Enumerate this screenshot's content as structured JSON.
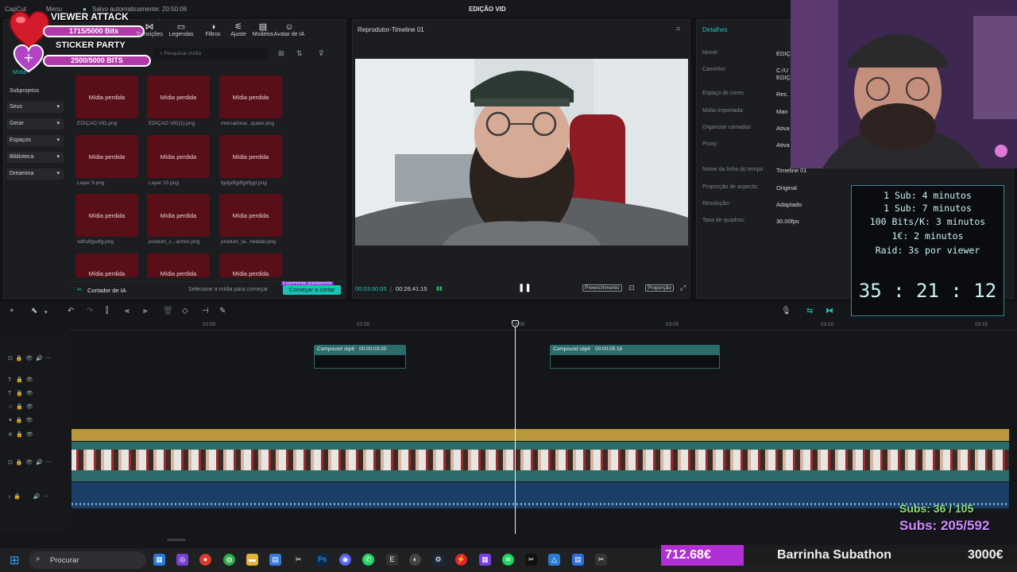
{
  "topbar": {
    "brand": "CapCut",
    "menu": "Menu",
    "autosave": "Salvo automaticamente: 20:50:06",
    "title": "EDIÇÃO VID"
  },
  "media_toolbar": [
    {
      "label": "Transições",
      "icon": "transitions-icon",
      "glyph": "⋈"
    },
    {
      "label": "Legendas",
      "icon": "captions-icon",
      "glyph": "▭"
    },
    {
      "label": "Filtros",
      "icon": "filters-icon",
      "glyph": "◑"
    },
    {
      "label": "Ajuste",
      "icon": "adjust-icon",
      "glyph": "⚟"
    },
    {
      "label": "Modelos",
      "icon": "templates-icon",
      "glyph": "▤"
    },
    {
      "label": "Avatar de IA",
      "icon": "ai-avatar-icon",
      "glyph": "☺"
    }
  ],
  "media_search_placeholder": "Pesquisar mídia",
  "sidebar": {
    "active": "Mídia",
    "items": [
      {
        "label": "Subprojetos",
        "box": false
      },
      {
        "label": "Seus",
        "box": true
      },
      {
        "label": "Gerar",
        "box": true
      },
      {
        "label": "Espaços",
        "box": true
      },
      {
        "label": "Biblioteca",
        "box": true
      },
      {
        "label": "Dreamina",
        "box": true
      }
    ]
  },
  "media": {
    "missing_label": "Mídia perdida",
    "rows": [
      [
        "EDIÇÃO VID.png",
        "EDIÇÃO VID(1).png",
        "mercadona...quare.png"
      ],
      [
        "Layer 9.png",
        "Layer 10.png",
        "fgdgdfgdfgdfggf.png"
      ],
      [
        "sdfsdfgsdfg.png",
        "produto_c...achos.png",
        "produto_ta...heddar.png"
      ],
      [
        "",
        "",
        ""
      ]
    ]
  },
  "ai_cutter": {
    "label": "Cortador de IA",
    "hint": "Selecione a mídia para começar",
    "badge": "Experimentar gratuitamente",
    "button": "Começar a cortar"
  },
  "player": {
    "title": "Reprodutor-Timeline 01",
    "current": "00:03:00:05",
    "total": "00:26:41:15",
    "fill_label": "Preenchimento",
    "ratio_label": "Proporção"
  },
  "details": {
    "title": "Detalhes",
    "rows": [
      {
        "k": "Nome:",
        "v": "EDIÇ"
      },
      {
        "k": "Caminho:",
        "v": "C:/U"
      },
      {
        "k": "",
        "v": "EDIÇ"
      },
      {
        "k": "Espaço de cores",
        "v": "Rec."
      },
      {
        "k": "Mídia importada:",
        "v": "Man"
      },
      {
        "k": "Organizar camadas",
        "v": "Ativa"
      },
      {
        "k": "Proxy:",
        "v": "Ativa"
      },
      {
        "k": "Nome da linha do tempo",
        "v": "Timeline 01"
      },
      {
        "k": "Proporção de aspecto:",
        "v": "Original"
      },
      {
        "k": "Resolução:",
        "v": "Adaptado"
      },
      {
        "k": "Taxa de quadros:",
        "v": "30.00fps"
      }
    ]
  },
  "timeline": {
    "ruler": [
      "02:50",
      "02:55",
      "03:00",
      "03:05",
      "03:10",
      "03:15"
    ],
    "clips": [
      {
        "name": "Compound clip6",
        "dur": "00:00:03:00"
      },
      {
        "name": "Compound clip4",
        "dur": "00:00:05:16"
      }
    ]
  },
  "overlay": {
    "viewer_attack": "VIEWER ATTACK",
    "bits_1": "1715/5000 Bits",
    "sticker_party": "STICKER PARTY",
    "bits_2": "2500/5000 BITS",
    "sub_lines": [
      "1 Sub: 4 minutos",
      "1 Sub: 7 minutos",
      "100 Bits/K: 3 minutos",
      "1€: 2 minutos",
      "Raid: 3s por viewer"
    ],
    "timer": "35 : 21 : 12",
    "subs_small": "Subs: 36 / 105",
    "subs_big": "Subs: 205/592",
    "donation": "712.68€",
    "bar_label": "Barrinha Subathon",
    "goal": "3000€"
  },
  "taskbar": {
    "search": "Procurar"
  },
  "colors": {
    "accent": "#19c3b5",
    "clip_teal": "#2b6b6a",
    "gold_track": "#b9973a",
    "audio_track": "#1a3e66",
    "missing_thumb": "#5a0f18",
    "overlay_pink": "#b23aa8"
  }
}
